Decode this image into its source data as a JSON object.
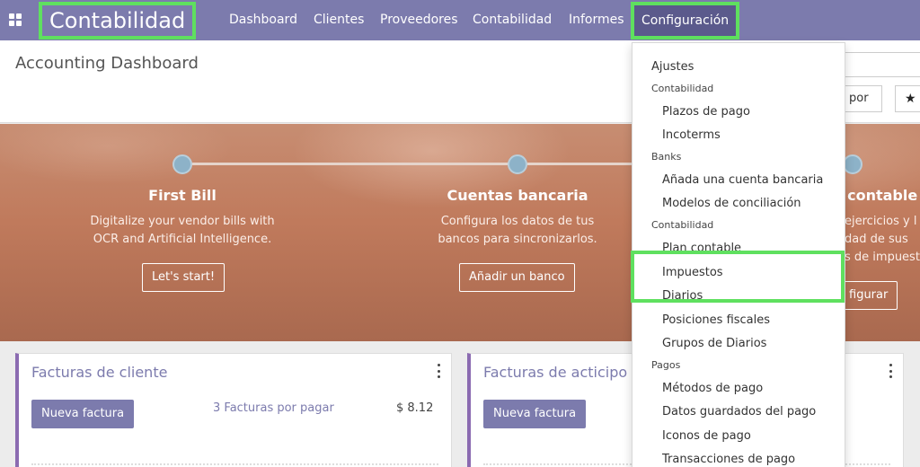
{
  "navbar": {
    "brand": "Contabilidad",
    "items": [
      "Dashboard",
      "Clientes",
      "Proveedores",
      "Contabilidad",
      "Informes"
    ],
    "active_item": "Configuración"
  },
  "control_panel": {
    "title": "Accounting Dashboard",
    "filter_label": "por",
    "favorites_icon": "star-icon"
  },
  "banner": {
    "steps": [
      {
        "title": "First Bill",
        "desc_line1": "Digitalize your vendor bills with",
        "desc_line2": "OCR and Artificial Intelligence.",
        "button": "Let's start!"
      },
      {
        "title": "Cuentas bancaria",
        "desc_line1": "Configura los datos de tus",
        "desc_line2": "bancos para sincronizarlos.",
        "button": "Añadir un banco"
      },
      {
        "title": "s contable",
        "desc_line1": "ejercicios y l",
        "desc_line2": "dad de sus",
        "desc_line3": "s de impuest",
        "button": "figurar"
      }
    ]
  },
  "cards": [
    {
      "title": "Facturas de cliente",
      "button": "Nueva factura",
      "link": "3 Facturas por pagar",
      "amount": "$ 8.12"
    },
    {
      "title": "Facturas de acticipo",
      "button": "Nueva factura"
    }
  ],
  "dropdown": {
    "entries": [
      {
        "kind": "top",
        "label": "Ajustes"
      },
      {
        "kind": "header",
        "label": "Contabilidad"
      },
      {
        "kind": "sub",
        "label": "Plazos de pago"
      },
      {
        "kind": "sub",
        "label": "Incoterms"
      },
      {
        "kind": "header",
        "label": "Banks"
      },
      {
        "kind": "sub",
        "label": "Añada una cuenta bancaria"
      },
      {
        "kind": "sub",
        "label": "Modelos de conciliación"
      },
      {
        "kind": "header",
        "label": "Contabilidad"
      },
      {
        "kind": "sub",
        "label": "Plan contable"
      },
      {
        "kind": "sub",
        "label": "Impuestos"
      },
      {
        "kind": "sub",
        "label": "Diarios"
      },
      {
        "kind": "sub",
        "label": "Posiciones fiscales"
      },
      {
        "kind": "sub",
        "label": "Grupos de Diarios"
      },
      {
        "kind": "header",
        "label": "Pagos"
      },
      {
        "kind": "sub",
        "label": "Métodos de pago"
      },
      {
        "kind": "sub",
        "label": "Datos guardados del pago"
      },
      {
        "kind": "sub",
        "label": "Iconos de pago"
      },
      {
        "kind": "sub",
        "label": "Transacciones de pago"
      }
    ]
  },
  "colors": {
    "navbar": "#7c7bad",
    "highlight": "#5fe05f",
    "banner": "#c07a5c",
    "card_accent": "#8b6bb1"
  }
}
